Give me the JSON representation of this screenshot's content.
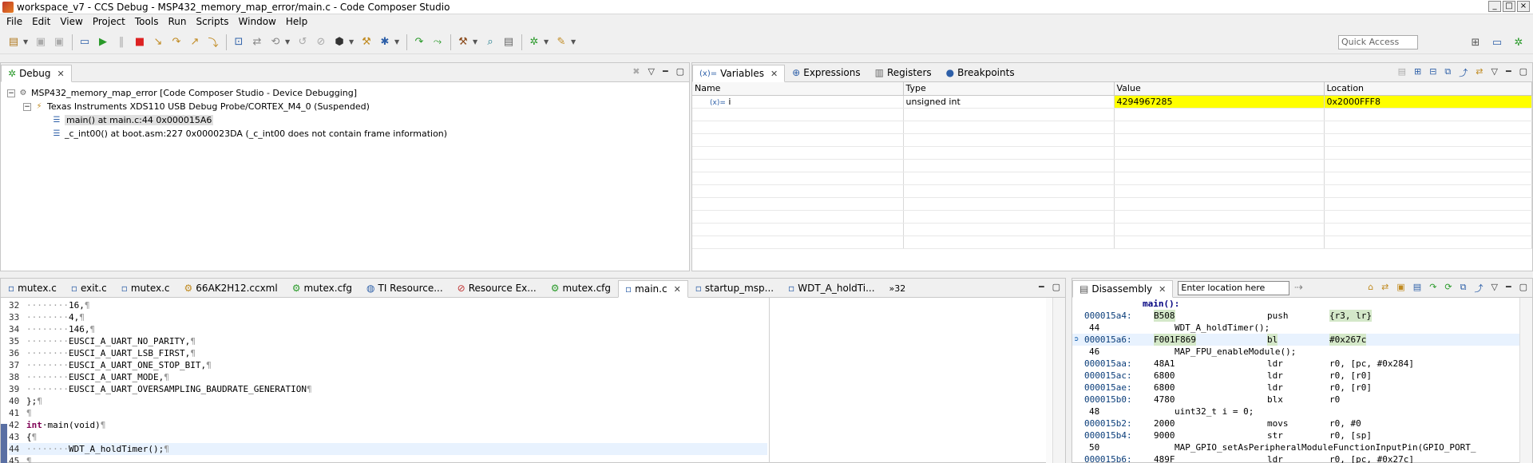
{
  "window": {
    "title": "workspace_v7 - CCS Debug - MSP432_memory_map_error/main.c - Code Composer Studio",
    "controls": [
      "_",
      "□",
      "×"
    ]
  },
  "menu": [
    "File",
    "Edit",
    "View",
    "Project",
    "Tools",
    "Run",
    "Scripts",
    "Window",
    "Help"
  ],
  "toolbar": {
    "quick_access_placeholder": "Quick Access"
  },
  "debug": {
    "tab": "Debug",
    "tree": [
      "MSP432_memory_map_error [Code Composer Studio - Device Debugging]",
      "Texas Instruments XDS110 USB Debug Probe/CORTEX_M4_0 (Suspended)",
      "main() at main.c:44 0x000015A6",
      "_c_int00() at boot.asm:227 0x000023DA  (_c_int00 does not contain frame information)"
    ]
  },
  "variables": {
    "tabs": [
      "Variables",
      "Expressions",
      "Registers",
      "Breakpoints"
    ],
    "columns": [
      "Name",
      "Type",
      "Value",
      "Location"
    ],
    "rows": [
      {
        "name": "i",
        "type": "unsigned int",
        "value": "4294967285",
        "location": "0x2000FFF8"
      }
    ],
    "highlight_color": "#ffff00"
  },
  "editor": {
    "tabs": [
      "mutex.c",
      "exit.c",
      "mutex.c",
      "66AK2H12.ccxml",
      "mutex.cfg",
      "TI Resource...",
      "Resource Ex...",
      "mutex.cfg",
      "main.c",
      "startup_msp...",
      "WDT_A_holdTi..."
    ],
    "overflow": "»32",
    "lines": [
      {
        "n": "32",
        "ws": "········",
        "code": "16,",
        "kw": ""
      },
      {
        "n": "33",
        "ws": "········",
        "code": "4,",
        "kw": ""
      },
      {
        "n": "34",
        "ws": "········",
        "code": "146,",
        "kw": ""
      },
      {
        "n": "35",
        "ws": "········",
        "code": "EUSCI_A_UART_NO_PARITY,",
        "kw": ""
      },
      {
        "n": "36",
        "ws": "········",
        "code": "EUSCI_A_UART_LSB_FIRST,",
        "kw": ""
      },
      {
        "n": "37",
        "ws": "········",
        "code": "EUSCI_A_UART_ONE_STOP_BIT,",
        "kw": ""
      },
      {
        "n": "38",
        "ws": "········",
        "code": "EUSCI_A_UART_MODE,",
        "kw": ""
      },
      {
        "n": "39",
        "ws": "········",
        "code": "EUSCI_A_UART_OVERSAMPLING_BAUDRATE_GENERATION",
        "kw": ""
      },
      {
        "n": "40",
        "ws": "",
        "code": "};",
        "kw": ""
      },
      {
        "n": "41",
        "ws": "",
        "code": "",
        "kw": ""
      },
      {
        "n": "42",
        "ws": "",
        "code": "·main(void)",
        "kw": "int"
      },
      {
        "n": "43",
        "ws": "",
        "code": "{",
        "kw": ""
      },
      {
        "n": "44",
        "ws": "········",
        "code": "WDT_A_holdTimer();",
        "kw": ""
      },
      {
        "n": "45",
        "ws": "",
        "code": "",
        "kw": ""
      }
    ]
  },
  "disassembly": {
    "tab": "Disassembly",
    "location_placeholder": "Enter location here",
    "label": "main():",
    "rows": [
      {
        "addr": "000015a4:",
        "opc": "B508",
        "mn": "push",
        "ops": "{r3, lr}"
      },
      {
        "src_num": "44",
        "src": "WDT_A_holdTimer();"
      },
      {
        "addr": "000015a6:",
        "opc": "F001F869",
        "mn": "bl",
        "ops": "#0x267c",
        "pc": true
      },
      {
        "src_num": "46",
        "src": "MAP_FPU_enableModule();"
      },
      {
        "addr": "000015aa:",
        "opc": "48A1",
        "mn": "ldr",
        "ops": "r0, [pc, #0x284]"
      },
      {
        "addr": "000015ac:",
        "opc": "6800",
        "mn": "ldr",
        "ops": "r0, [r0]"
      },
      {
        "addr": "000015ae:",
        "opc": "6800",
        "mn": "ldr",
        "ops": "r0, [r0]"
      },
      {
        "addr": "000015b0:",
        "opc": "4780",
        "mn": "blx",
        "ops": "r0"
      },
      {
        "src_num": "48",
        "src": "uint32_t i = 0;"
      },
      {
        "addr": "000015b2:",
        "opc": "2000",
        "mn": "movs",
        "ops": "r0, #0"
      },
      {
        "addr": "000015b4:",
        "opc": "9000",
        "mn": "str",
        "ops": "r0, [sp]"
      },
      {
        "src_num": "50",
        "src": "MAP_GPIO_setAsPeripheralModuleFunctionInputPin(GPIO_PORT_"
      },
      {
        "addr": "000015b6:",
        "opc": "489F",
        "mn": "ldr",
        "ops": "r0, [pc, #0x27c]"
      }
    ]
  }
}
